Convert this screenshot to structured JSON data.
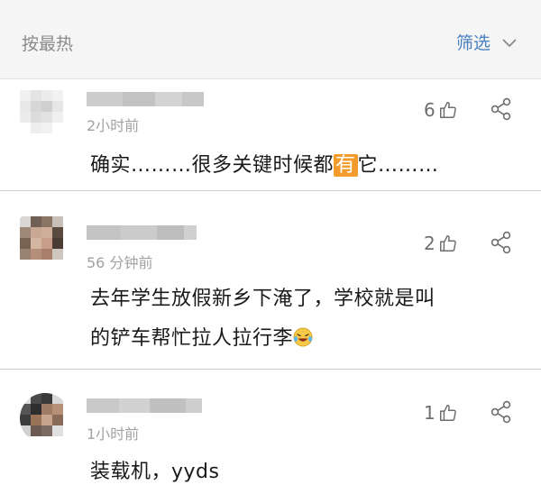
{
  "header": {
    "sort_label": "按最热",
    "filter_label": "筛选"
  },
  "comments": [
    {
      "time": "2小时前",
      "likes": "6",
      "text_parts": [
        "确实………很多关键时候都",
        "有",
        "它………"
      ]
    },
    {
      "time": "56 分钟前",
      "likes": "2",
      "lines": [
        "去年学生放假新乡下淹了，学校就是叫",
        "的铲车帮忙拉人拉行李"
      ]
    },
    {
      "time": "1小时前",
      "likes": "1",
      "text": "装载机，yyds"
    }
  ],
  "colors": {
    "accent": "#4a7fc0",
    "highlight": "#f39c2b",
    "meta": "#a2a2a2"
  }
}
